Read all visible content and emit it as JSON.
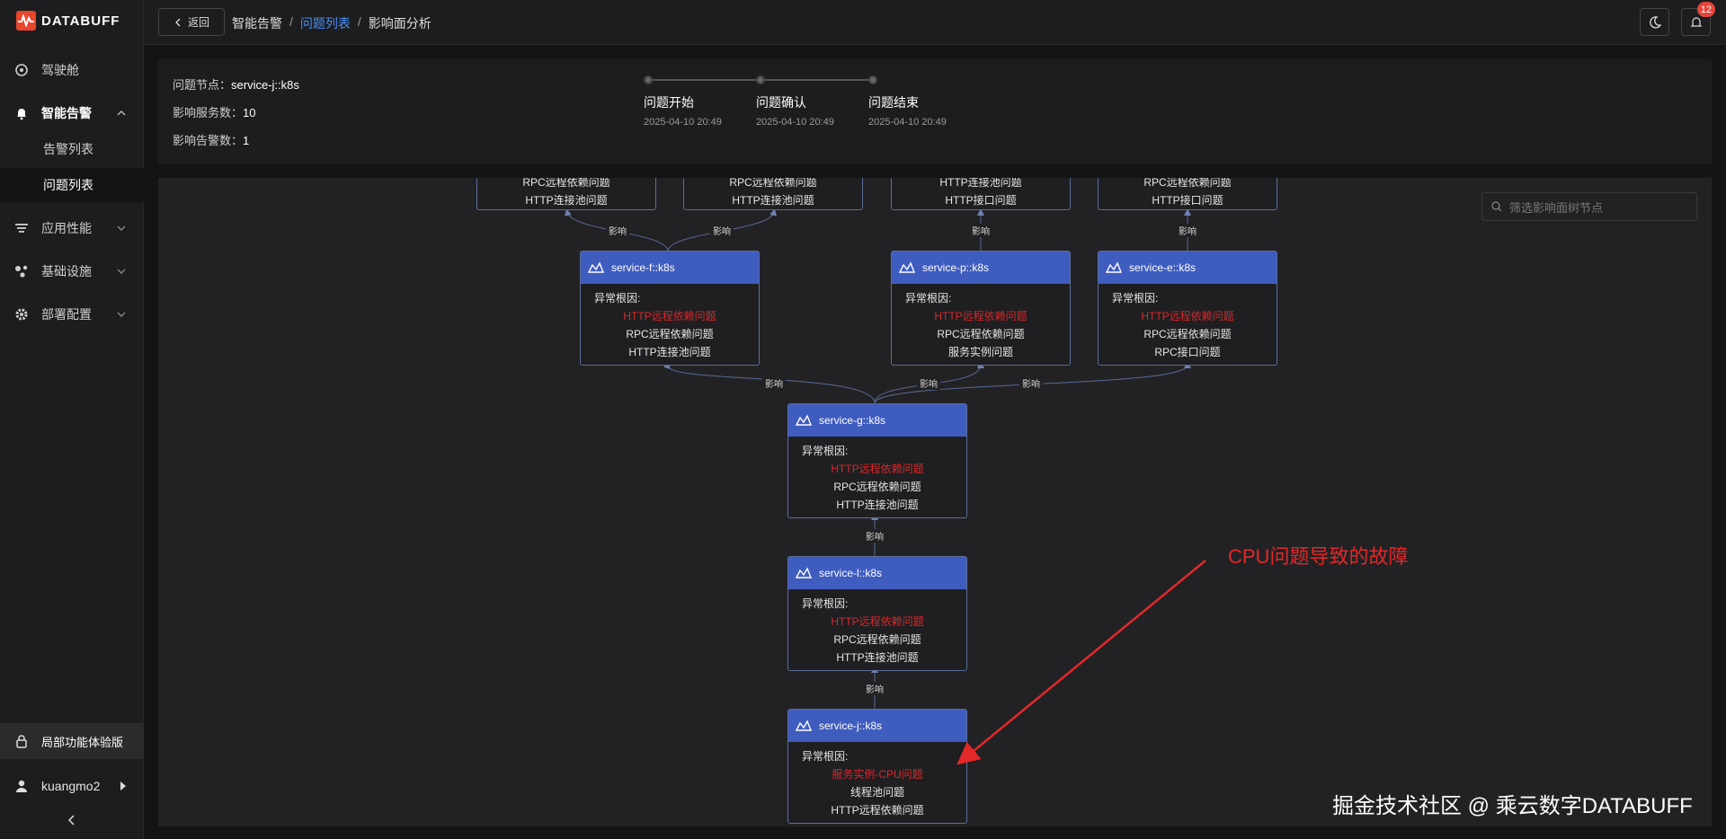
{
  "brand": {
    "name": "DATABUFF"
  },
  "sidebar": {
    "items": [
      {
        "label": "驾驶舱",
        "icon": "dashboard-icon"
      },
      {
        "label": "智能告警",
        "icon": "bell-icon",
        "open": true,
        "children": [
          {
            "label": "告警列表"
          },
          {
            "label": "问题列表",
            "active": true
          }
        ]
      },
      {
        "label": "应用性能",
        "icon": "filter-icon"
      },
      {
        "label": "基础设施",
        "icon": "cluster-icon"
      },
      {
        "label": "部署配置",
        "icon": "gear-icon"
      }
    ],
    "trial_label": "局部功能体验版",
    "user_name": "kuangmo2"
  },
  "header": {
    "back_label": "返回",
    "breadcrumbs": [
      "智能告警",
      "问题列表",
      "影响面分析"
    ],
    "notification_count": "12"
  },
  "info": {
    "node_label": "问题节点：",
    "node_value": "service-j::k8s",
    "services_label": "影响服务数：",
    "services_value": "10",
    "alerts_label": "影响告警数：",
    "alerts_value": "1",
    "timeline": [
      {
        "label": "问题开始",
        "time": "2025-04-10 20:49"
      },
      {
        "label": "问题确认",
        "time": "2025-04-10 20:49"
      },
      {
        "label": "问题结束",
        "time": "2025-04-10 20:49"
      }
    ]
  },
  "graph": {
    "search_placeholder": "筛选影响面树节点",
    "cause_title": "异常根因:",
    "edge_label": "影响",
    "top_nodes": [
      {
        "line1": "RPC远程依赖问题",
        "line2": "HTTP连接池问题"
      },
      {
        "line1": "RPC远程依赖问题",
        "line2": "HTTP连接池问题"
      },
      {
        "line1": "HTTP连接池问题",
        "line2": "HTTP接口问题"
      },
      {
        "line1": "RPC远程依赖问题",
        "line2": "HTTP接口问题"
      }
    ],
    "nodes": {
      "f": {
        "name": "service-f::k8s",
        "causes": [
          "HTTP远程依赖问题",
          "RPC远程依赖问题",
          "HTTP连接池问题"
        ]
      },
      "p": {
        "name": "service-p::k8s",
        "causes": [
          "HTTP远程依赖问题",
          "RPC远程依赖问题",
          "服务实例问题"
        ]
      },
      "e": {
        "name": "service-e::k8s",
        "causes": [
          "HTTP远程依赖问题",
          "RPC远程依赖问题",
          "RPC接口问题"
        ]
      },
      "g": {
        "name": "service-g::k8s",
        "causes": [
          "HTTP远程依赖问题",
          "RPC远程依赖问题",
          "HTTP连接池问题"
        ]
      },
      "l": {
        "name": "service-l::k8s",
        "causes": [
          "HTTP远程依赖问题",
          "RPC远程依赖问题",
          "HTTP连接池问题"
        ]
      },
      "j": {
        "name": "service-j::k8s",
        "causes": [
          "服务实例-CPU问题",
          "线程池问题",
          "HTTP远程依赖问题"
        ]
      }
    }
  },
  "annotation": "CPU问题导致的故障",
  "watermark": "掘金技术社区 @ 乘云数字DATABUFF",
  "colors": {
    "accent": "#3f5cbf",
    "link": "#4a8df5",
    "alert_red": "#d8282c",
    "annotation_red": "#e3282a"
  }
}
